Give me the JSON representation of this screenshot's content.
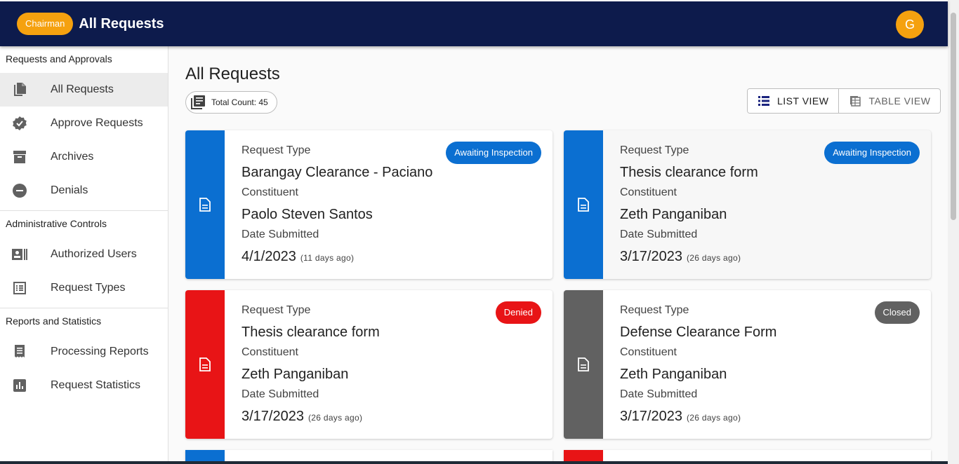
{
  "header": {
    "role": "Chairman",
    "title": "All Requests",
    "avatar_initial": "G"
  },
  "sidebar": {
    "sections": [
      {
        "heading": "Requests and Approvals",
        "items": [
          "All Requests",
          "Approve Requests",
          "Archives",
          "Denials"
        ]
      },
      {
        "heading": "Administrative Controls",
        "items": [
          "Authorized Users",
          "Request Types"
        ]
      },
      {
        "heading": "Reports and Statistics",
        "items": [
          "Processing Reports",
          "Request Statistics"
        ]
      }
    ],
    "active": "All Requests"
  },
  "main": {
    "title": "All Requests",
    "total_count": "Total Count: 45",
    "view": {
      "list": "LIST VIEW",
      "table": "TABLE VIEW"
    },
    "labels": {
      "type": "Request Type",
      "constituent": "Constituent",
      "date": "Date Submitted"
    },
    "cards": [
      {
        "request_type": "Barangay Clearance - Paciano",
        "constituent": "Paolo Steven Santos",
        "date": "4/1/2023",
        "ago": "(11 days ago)",
        "status": "Awaiting Inspection",
        "color": "#0b6fd1"
      },
      {
        "request_type": "Thesis clearance form",
        "constituent": "Zeth Panganiban",
        "date": "3/17/2023",
        "ago": "(26 days ago)",
        "status": "Awaiting Inspection",
        "color": "#0b6fd1"
      },
      {
        "request_type": "Thesis clearance form",
        "constituent": "Zeth Panganiban",
        "date": "3/17/2023",
        "ago": "(26 days ago)",
        "status": "Denied",
        "color": "#e81416"
      },
      {
        "request_type": "Defense Clearance Form",
        "constituent": "Zeth Panganiban",
        "date": "3/17/2023",
        "ago": "(26 days ago)",
        "status": "Closed",
        "color": "#616161"
      }
    ]
  },
  "colors": {
    "appbar": "#0d1b4c",
    "accent": "#f5a10f",
    "blue": "#0b6fd1",
    "red": "#e81416",
    "gray": "#616161"
  },
  "icons": [
    "file-copy-icon",
    "verified-icon",
    "archive-icon",
    "minus-circle-icon",
    "badge-icon",
    "list-alt-icon",
    "receipt-icon",
    "bar-chart-icon",
    "document-icon",
    "list-icon",
    "table-icon"
  ]
}
